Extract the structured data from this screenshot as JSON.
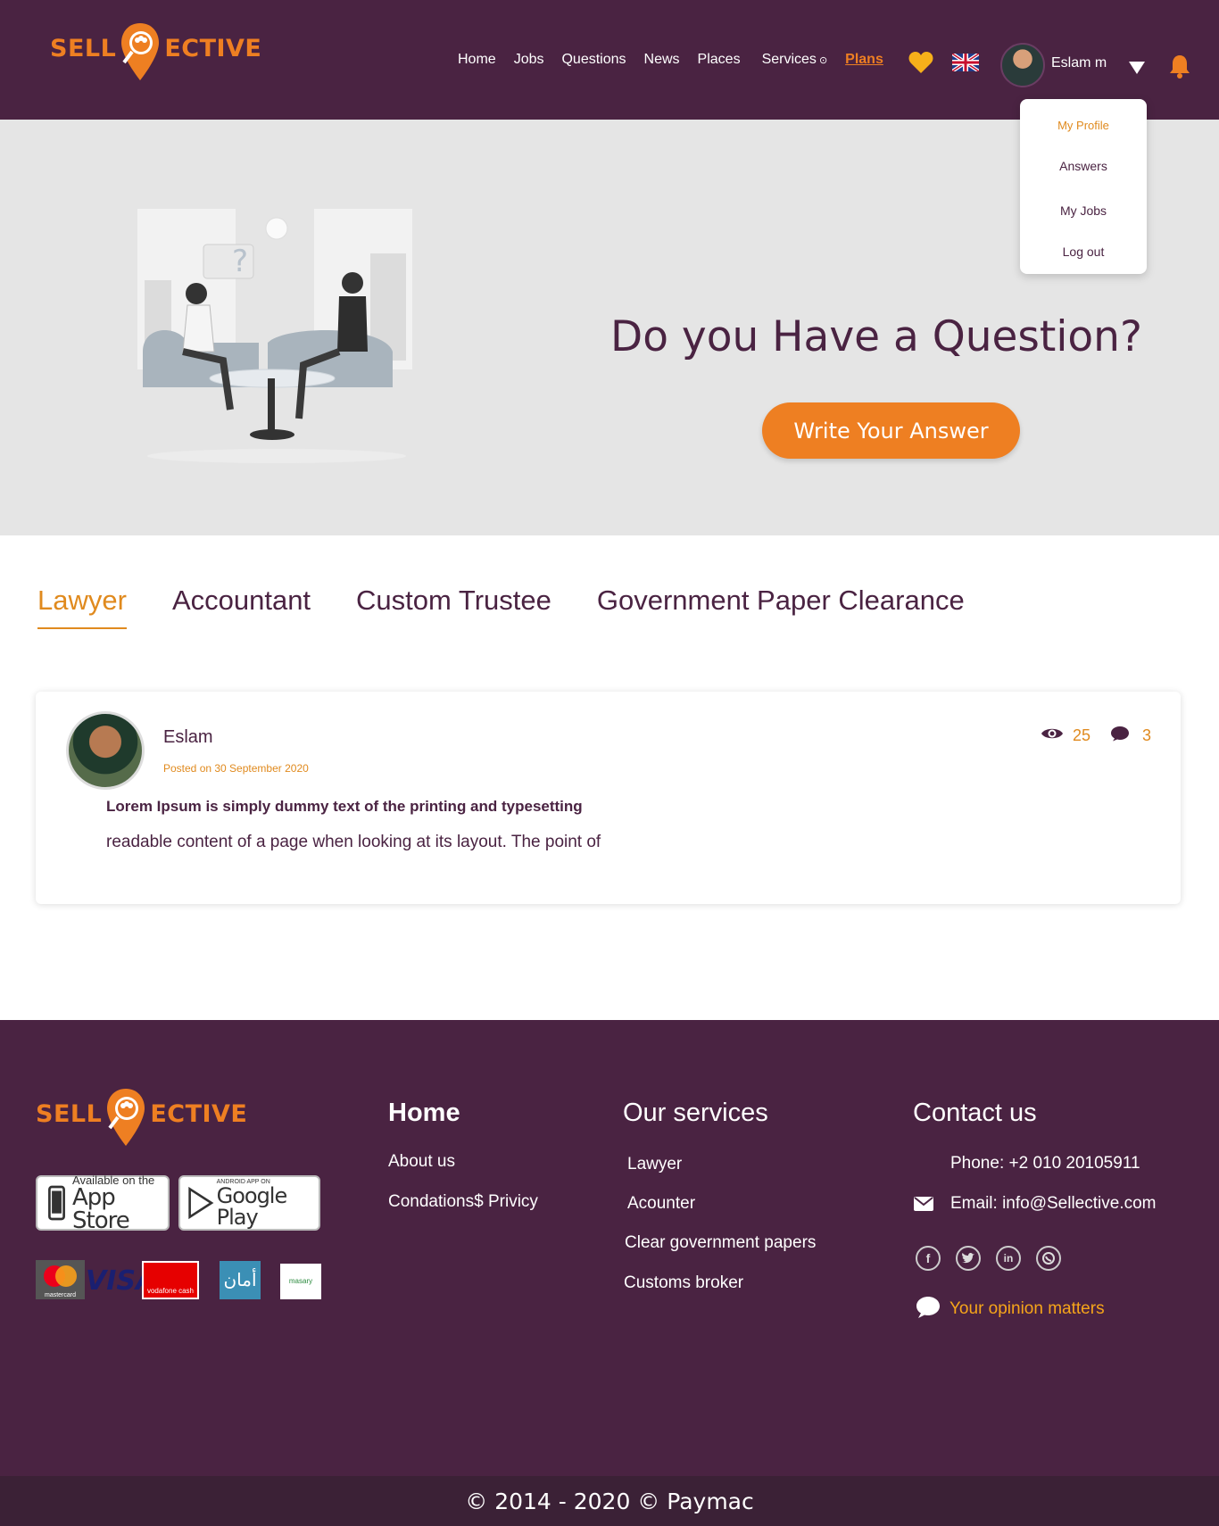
{
  "brand": {
    "left": "SELL",
    "right": "ECTIVE"
  },
  "nav": {
    "home": "Home",
    "jobs": "Jobs",
    "questions": "Questions",
    "news": "News",
    "places": "Places",
    "services": "Services",
    "services_icon": "⊙",
    "plans": "Plans"
  },
  "header_icons": [
    "heart-icon",
    "uk-flag-icon",
    "caret-down-icon",
    "bell-icon"
  ],
  "user": {
    "name": "Eslam m"
  },
  "dropdown": {
    "my_profile": "My Profile",
    "answers": "Answers",
    "my_jobs": "My Jobs",
    "log_out": "Log out"
  },
  "hero": {
    "title": "Do you Have a Question?",
    "button": "Write Your Answer"
  },
  "tabs": [
    {
      "label": "Lawyer",
      "active": true
    },
    {
      "label": "Accountant",
      "active": false
    },
    {
      "label": "Custom Trustee",
      "active": false
    },
    {
      "label": "Government Paper Clearance",
      "active": false
    }
  ],
  "post": {
    "author": "Eslam",
    "date": "Posted on 30 September 2020",
    "views": "25",
    "comments": "3",
    "heading": "Lorem Ipsum is simply dummy text of the printing and typesetting",
    "body": "readable content of a page when looking at its layout. The point of"
  },
  "footer": {
    "app_store": {
      "small": "Available on the",
      "big": "App Store"
    },
    "google_play": {
      "small": "ANDROID APP ON",
      "big": "Google Play"
    },
    "payment_logos": {
      "visa": "VISA",
      "mastercard": "mastercard",
      "vodafone": "vodafone cash",
      "aman": "أمان",
      "masary": "masary"
    },
    "col_home": {
      "title": "Home",
      "links": [
        "About us",
        "Condations$ Privicy"
      ]
    },
    "col_services": {
      "title": "Our services",
      "links": [
        "Lawyer",
        "Acounter",
        "Clear government papers",
        "Customs broker"
      ]
    },
    "col_contact": {
      "title": "Contact us",
      "phone": "Phone: +2 010 20105911",
      "email": "Email: info@Sellective.com",
      "opinion": "Your opinion matters"
    }
  },
  "copyright": "© 2014 - 2020 © Paymac",
  "colors": {
    "primary": "#4a2342",
    "accent": "#ee7f22",
    "hero_bg": "#e5e5e5"
  }
}
